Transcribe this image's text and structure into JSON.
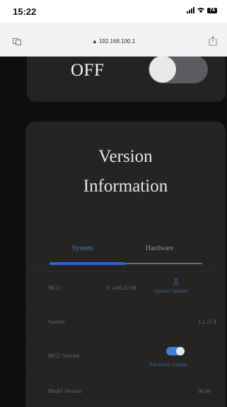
{
  "status_bar": {
    "time": "15:22",
    "battery": "74"
  },
  "browser": {
    "url": "▲ 192.168.100.1"
  },
  "power_card": {
    "state_label": "OFF",
    "toggle_on": false
  },
  "version_card": {
    "title_line1": "Version",
    "title_line2": "Information",
    "tabs": [
      {
        "label": "System",
        "active": true
      },
      {
        "label": "Hardware",
        "active": false
      }
    ],
    "active_tab_progress": 0.5,
    "rows": [
      {
        "label": "MCU",
        "value": "V. 4.00.22.08",
        "action": "Upload Updates"
      },
      {
        "label": "System",
        "value": "1.2.17.4"
      },
      {
        "label": "MCU Version",
        "action": "Automatic Update",
        "toggle_on": true
      },
      {
        "label": "Model Version",
        "value": "06.00"
      }
    ]
  },
  "colors": {
    "accent": "#2b66c4",
    "background": "#0e0d0f",
    "card": "#262422"
  }
}
